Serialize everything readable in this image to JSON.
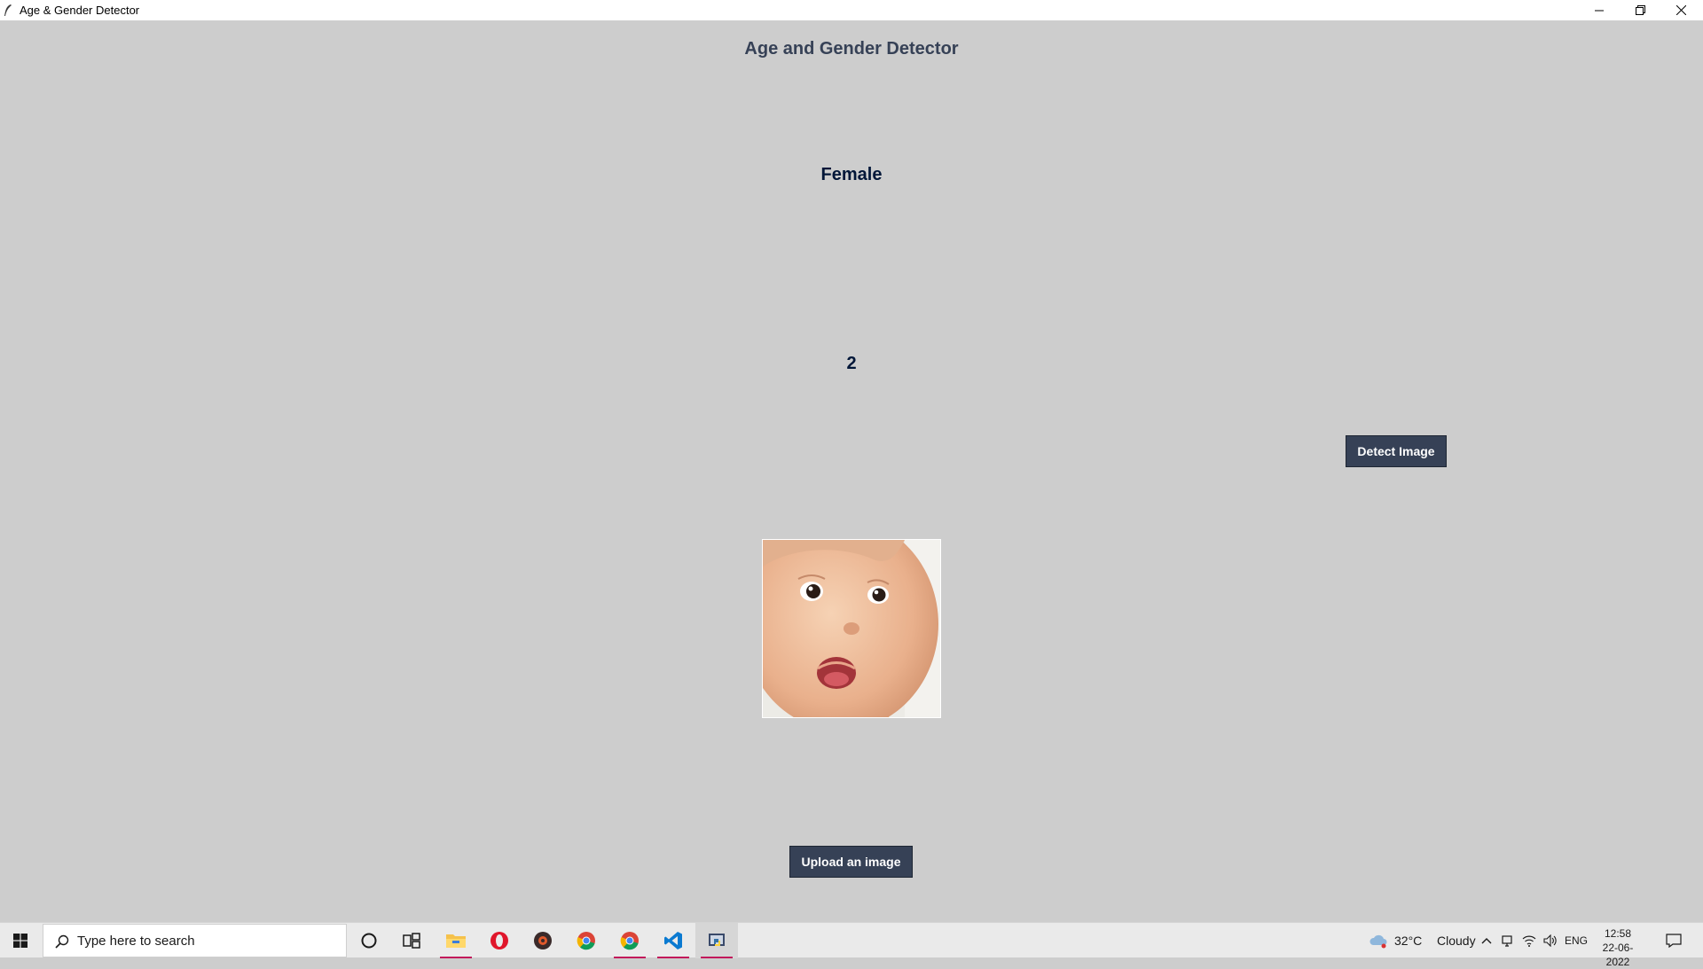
{
  "window": {
    "title": "Age & Gender Detector"
  },
  "app": {
    "heading": "Age and Gender Detector",
    "gender_result": "Female",
    "age_result": "2",
    "detect_button": "Detect Image",
    "upload_button": "Upload an image",
    "image_subject": "baby face photo"
  },
  "colors": {
    "background": "#cdcdcd",
    "heading": "#364156",
    "result_text": "#011638",
    "button_bg": "#364156",
    "button_text": "#ffffff"
  },
  "taskbar": {
    "search_placeholder": "Type here to search",
    "pinned_apps": [
      "cortana-icon",
      "task-view-icon",
      "file-explorer-icon",
      "opera-icon",
      "music-player-icon",
      "chrome-icon",
      "chrome-icon",
      "vscode-icon",
      "python-icon"
    ],
    "weather_temp": "32°C",
    "weather_condition": "Cloudy",
    "language": "ENG",
    "time": "12:58",
    "date": "22-06-2022"
  }
}
